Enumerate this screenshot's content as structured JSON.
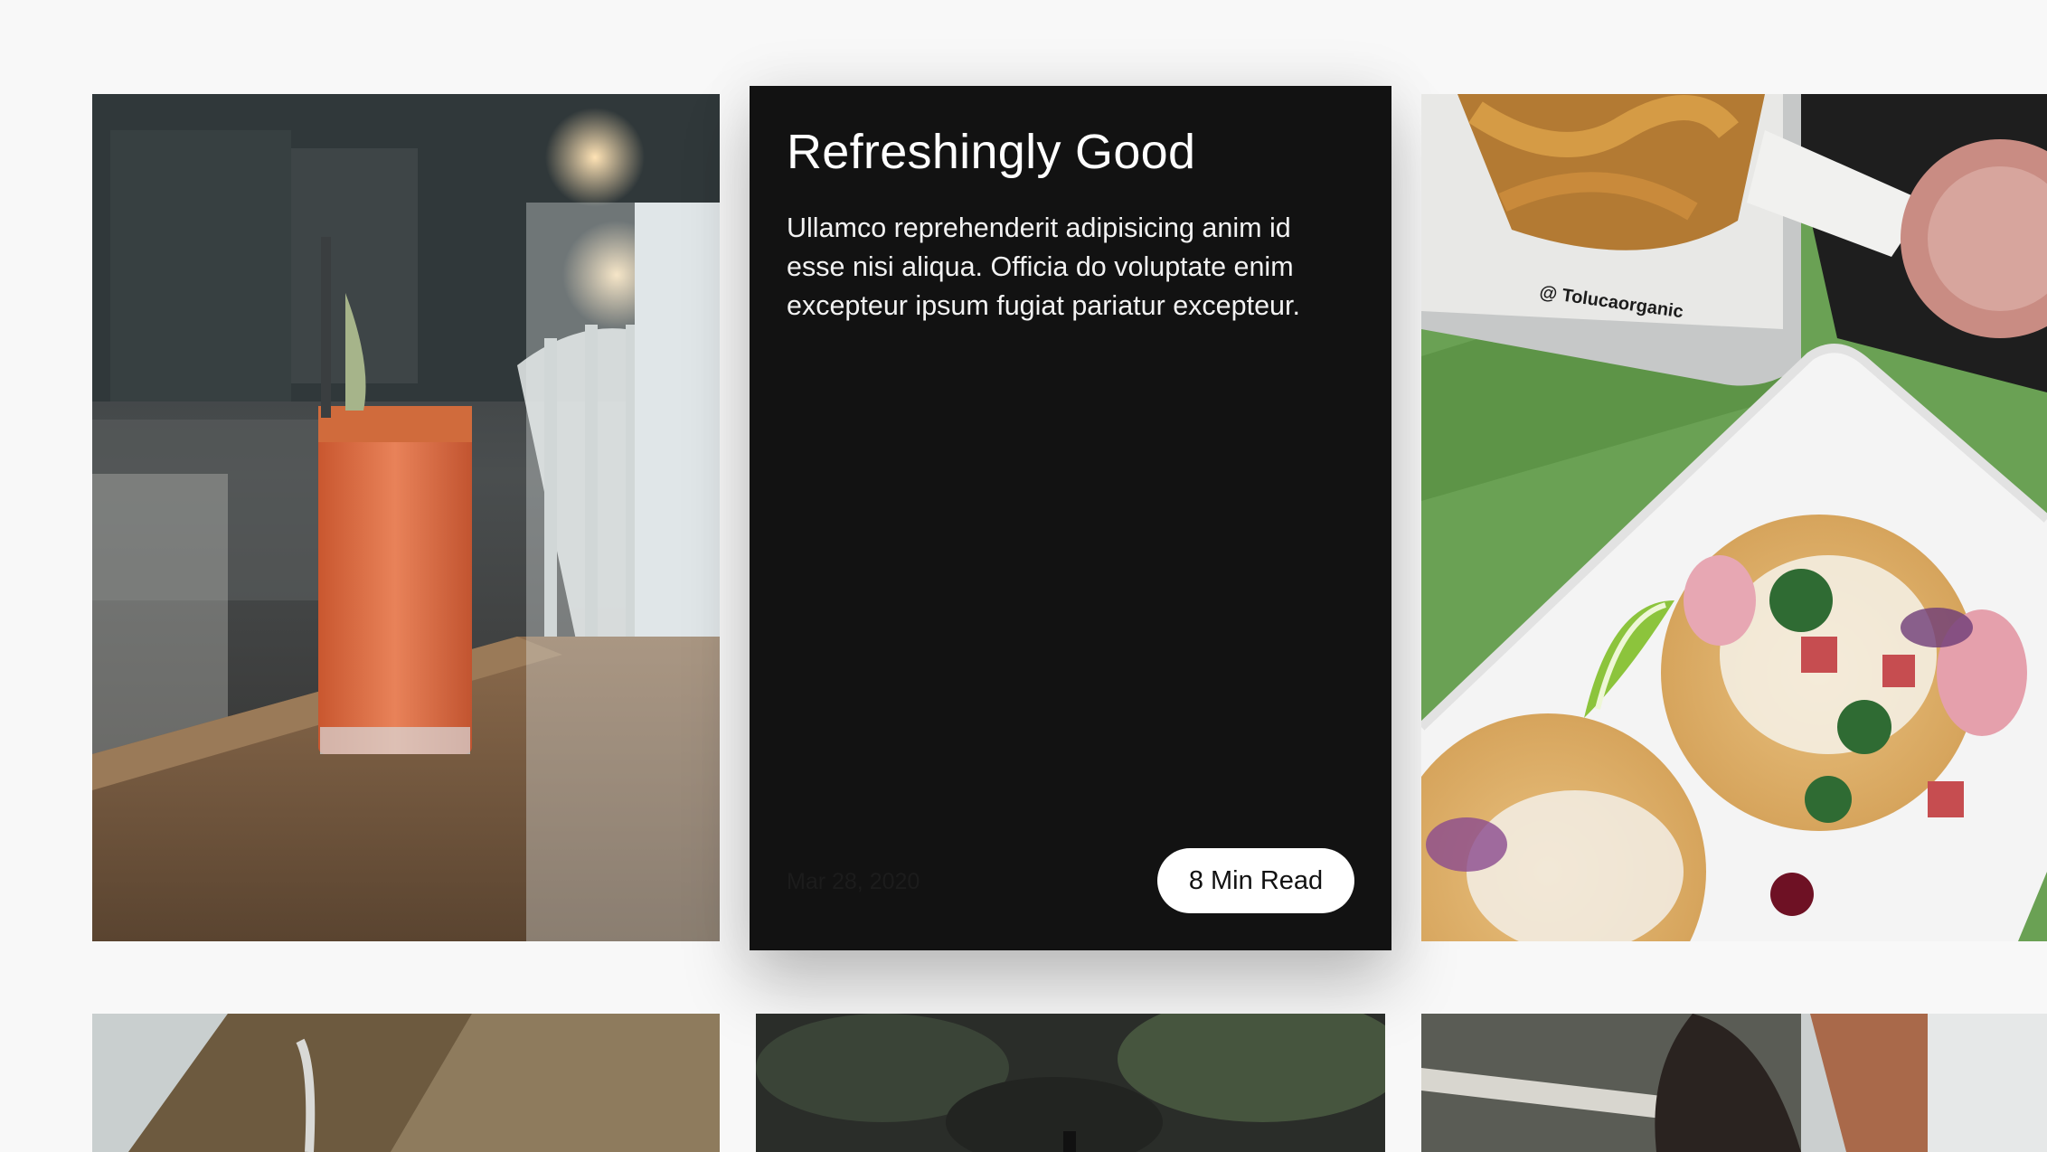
{
  "featured_card": {
    "title": "Refreshingly Good",
    "body": "Ullamco reprehenderit adipisicing anim id esse nisi aliqua. Officia do voluptate enim excepteur ipsum fugiat pariatur excepteur.",
    "date": "Mar 28, 2020",
    "read_time": "8 Min Read"
  },
  "photo_cards": [
    {
      "image": "red-drink-on-table-photo"
    },
    {
      "image": "tacos-platter-photo",
      "caption_text": "@ Tolucaorganic"
    },
    {
      "image": "wooden-table-photo"
    },
    {
      "image": "dark-greenery-photo"
    },
    {
      "image": "person-portrait-photo"
    }
  ],
  "colors": {
    "page_background": "#f8f8f8",
    "card_background": "#121212",
    "button_background": "#ffffff"
  }
}
